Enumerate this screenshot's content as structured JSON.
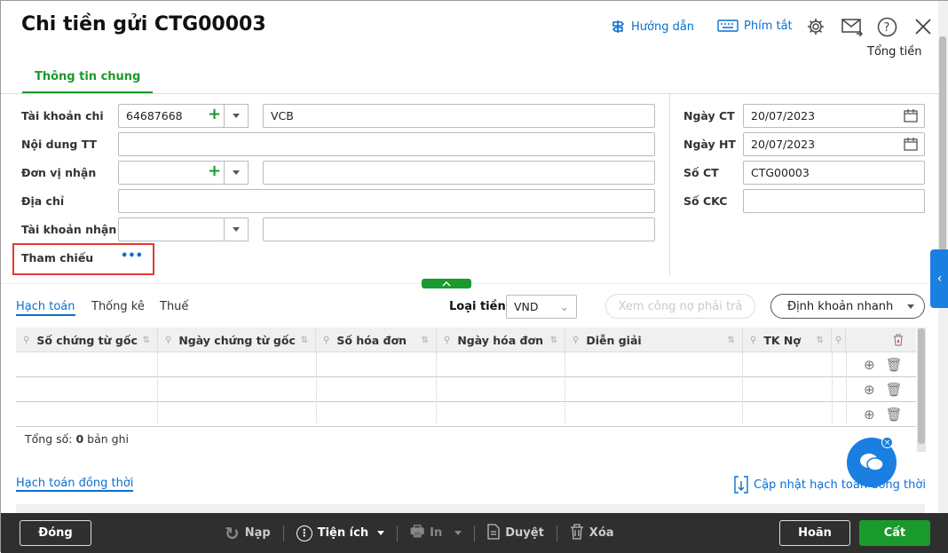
{
  "title": "Chi tiền gửi CTG00003",
  "header": {
    "guide": "Hướng dẫn",
    "shortcuts": "Phím tắt",
    "total_label": "Tổng tiền"
  },
  "tabs": {
    "general": "Thông tin chung"
  },
  "form": {
    "tk_chi_label": "Tài khoản chi",
    "tk_chi_value": "64687668",
    "tk_chi_name": "VCB",
    "noi_dung_label": "Nội dung TT",
    "noi_dung_value": "",
    "don_vi_label": "Đơn vị nhận",
    "don_vi_value": "",
    "don_vi_name": "",
    "dia_chi_label": "Địa chỉ",
    "dia_chi_value": "",
    "tk_nhan_label": "Tài khoản nhận",
    "tk_nhan_value": "",
    "tk_nhan_name": "",
    "tham_chieu_label": "Tham chiếu",
    "tham_chieu_more": "•••",
    "ngay_ct_label": "Ngày CT",
    "ngay_ct_value": "20/07/2023",
    "ngay_ht_label": "Ngày HT",
    "ngay_ht_value": "20/07/2023",
    "so_ct_label": "Số CT",
    "so_ct_value": "CTG00003",
    "so_ckc_label": "Số CKC",
    "so_ckc_value": ""
  },
  "detail": {
    "tabs": [
      "Hạch toán",
      "Thống kê",
      "Thuế"
    ],
    "currency_label": "Loại tiền",
    "currency_value": "VND",
    "view_debt": "Xem công nợ phải trả",
    "quick_entry": "Định khoản nhanh",
    "columns": [
      "Số chứng từ gốc",
      "Ngày chứng từ gốc",
      "Số hóa đơn",
      "Ngày hóa đơn",
      "Diễn giải",
      "TK Nợ"
    ],
    "total_prefix": "Tổng số:",
    "total_count": "0",
    "total_suffix": "bản ghi",
    "simultaneous": "Hạch toán đồng thời",
    "update_simultaneous": "Cập nhật hạch toán đồng thời"
  },
  "footer": {
    "close": "Đóng",
    "reload": "Nạp",
    "utilities": "Tiện ích",
    "print": "In",
    "approve": "Duyệt",
    "delete": "Xóa",
    "cancel": "Hoãn",
    "save": "Cất"
  },
  "colors": {
    "accent": "#1a9a2c",
    "link": "#0b6fcf",
    "footer": "#2f2f2f",
    "highlight": "#e53935"
  }
}
